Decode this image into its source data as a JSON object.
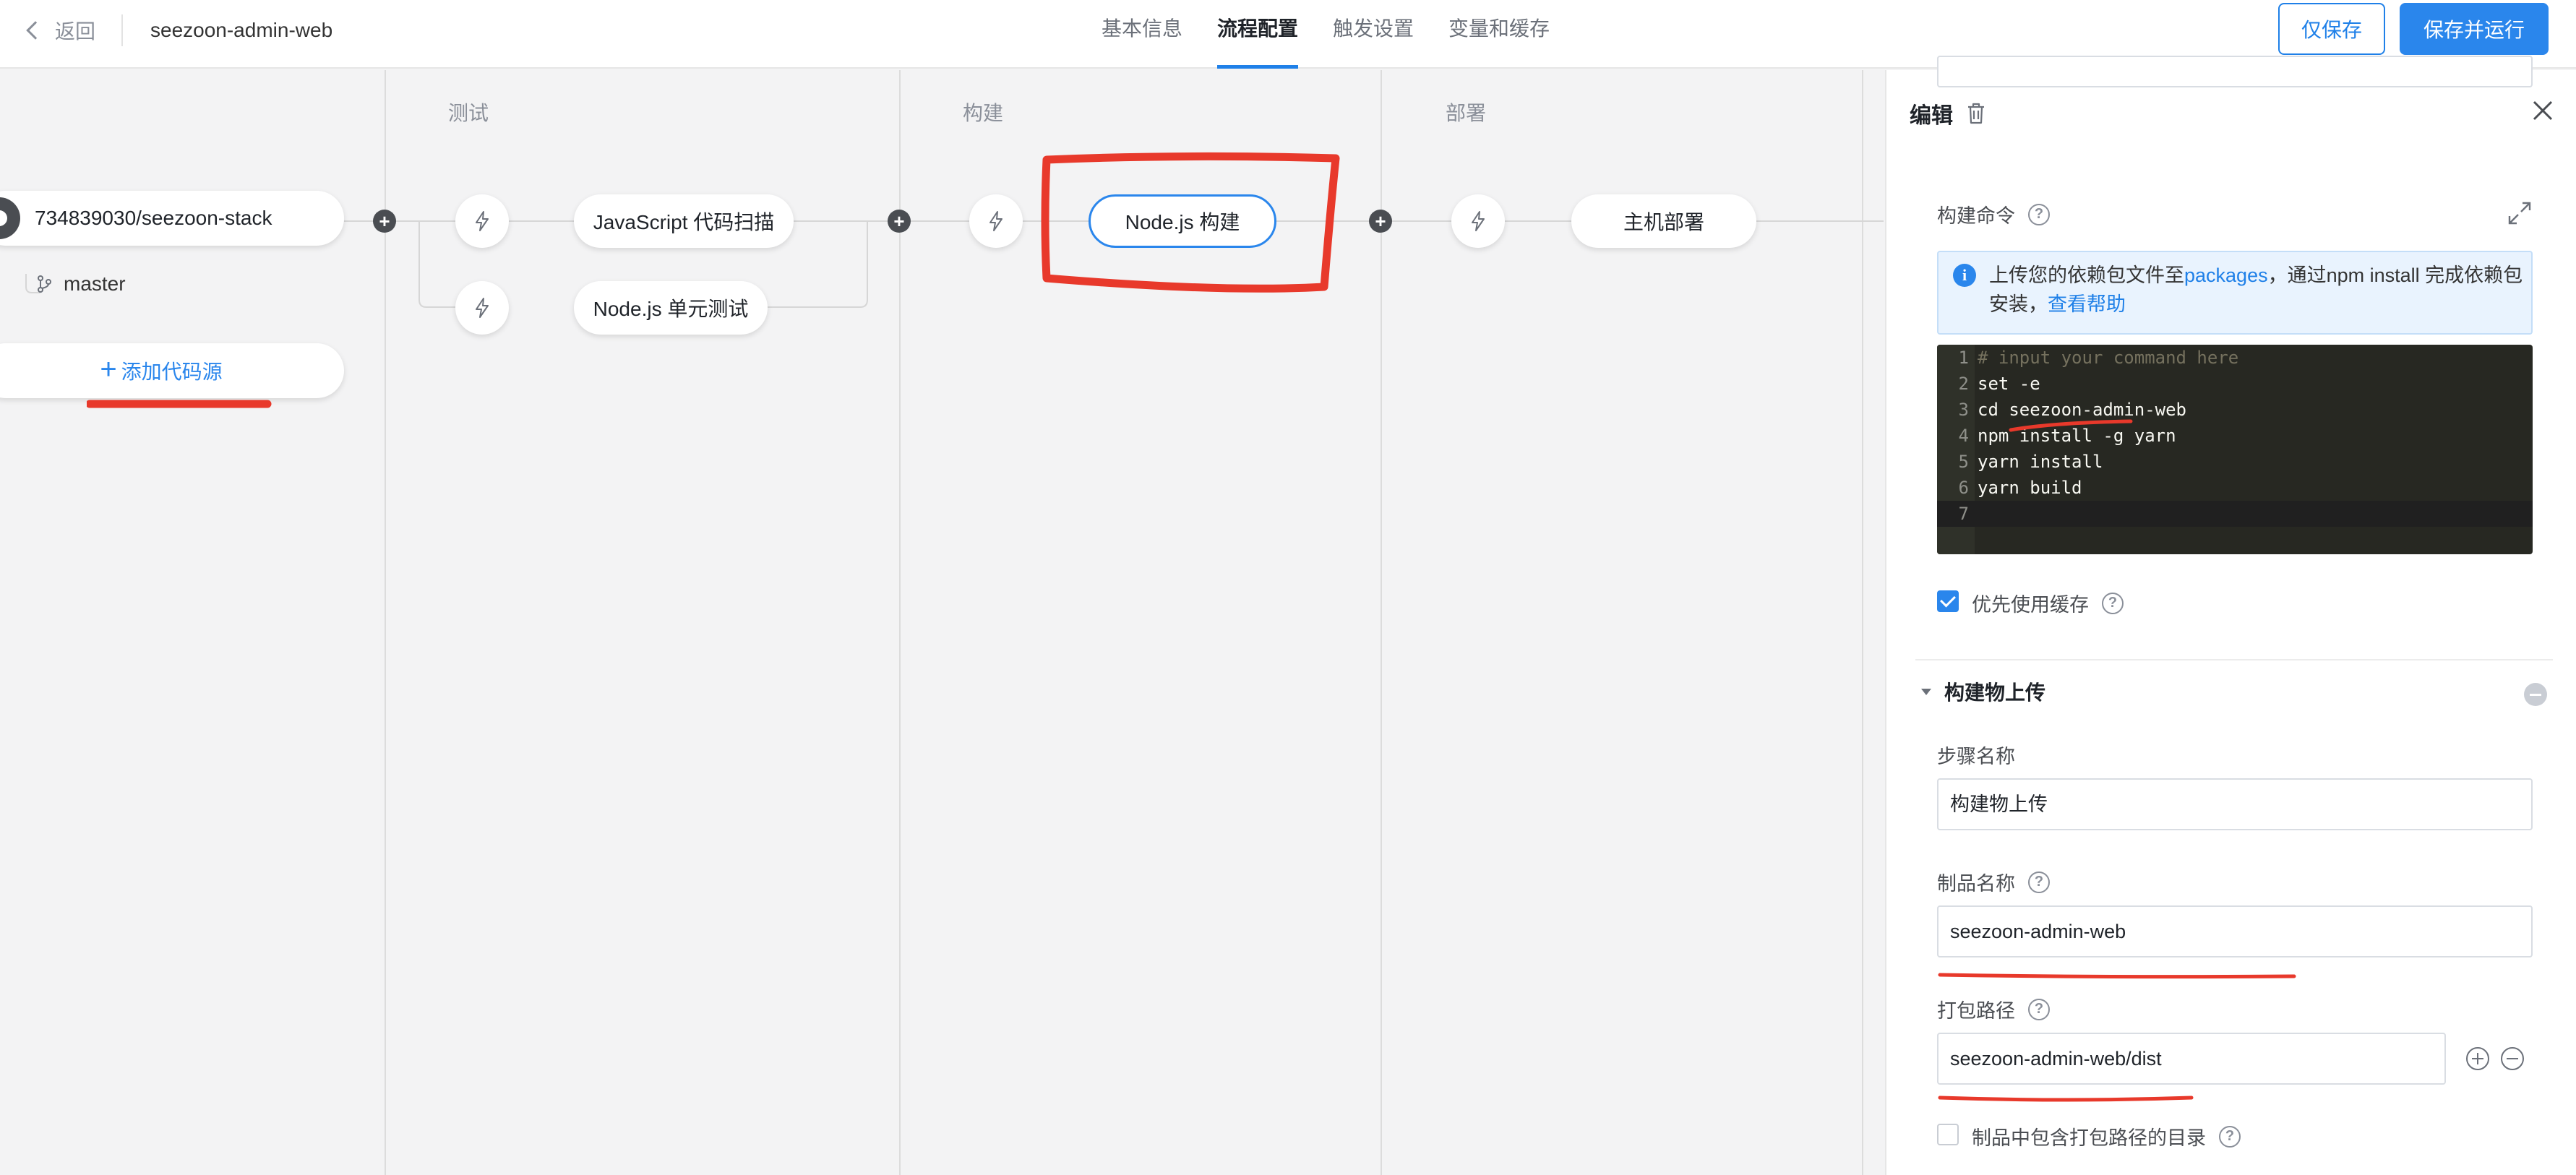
{
  "header": {
    "back_label": "返回",
    "project_name": "seezoon-admin-web",
    "tabs": [
      {
        "label": "基本信息"
      },
      {
        "label": "流程配置",
        "active": true
      },
      {
        "label": "触发设置"
      },
      {
        "label": "变量和缓存"
      }
    ],
    "save_label": "仅保存",
    "save_run_label": "保存并运行"
  },
  "pipeline": {
    "source": {
      "repo": "734839030/seezoon-stack",
      "branch": "master",
      "add_label": "添加代码源"
    },
    "stages": [
      {
        "label": "测试",
        "jobs": [
          "JavaScript 代码扫描",
          "Node.js 单元测试"
        ]
      },
      {
        "label": "构建",
        "jobs": [
          "Node.js 构建"
        ]
      },
      {
        "label": "部署",
        "jobs": [
          "主机部署"
        ]
      }
    ]
  },
  "panel": {
    "title": "编辑",
    "build_cmd_label": "构建命令",
    "info": {
      "text_1": "上传您的依赖包文件至",
      "link_1": "packages",
      "text_2": "，通过npm install 完成依赖包安装，",
      "link_2": "查看帮助"
    },
    "code_lines": [
      {
        "no": "1",
        "text": "# input your command here"
      },
      {
        "no": "2",
        "text": "set -e"
      },
      {
        "no": "3",
        "text": "cd seezoon-admin-web"
      },
      {
        "no": "4",
        "text": "npm install -g yarn"
      },
      {
        "no": "5",
        "text": "yarn install"
      },
      {
        "no": "6",
        "text": "yarn build"
      },
      {
        "no": "7",
        "text": ""
      }
    ],
    "cache_label": "优先使用缓存",
    "cache_checked": true,
    "section_title": "构建物上传",
    "step_name_label": "步骤名称",
    "step_name_value": "构建物上传",
    "artifact_name_label": "制品名称",
    "artifact_name_value": "seezoon-admin-web",
    "pack_path_label": "打包路径",
    "pack_path_value": "seezoon-admin-web/dist",
    "include_dir_label": "制品中包含打包路径的目录",
    "include_dir_checked": false
  },
  "colors": {
    "accent": "#2a86ec",
    "annotation": "#e8392b"
  }
}
